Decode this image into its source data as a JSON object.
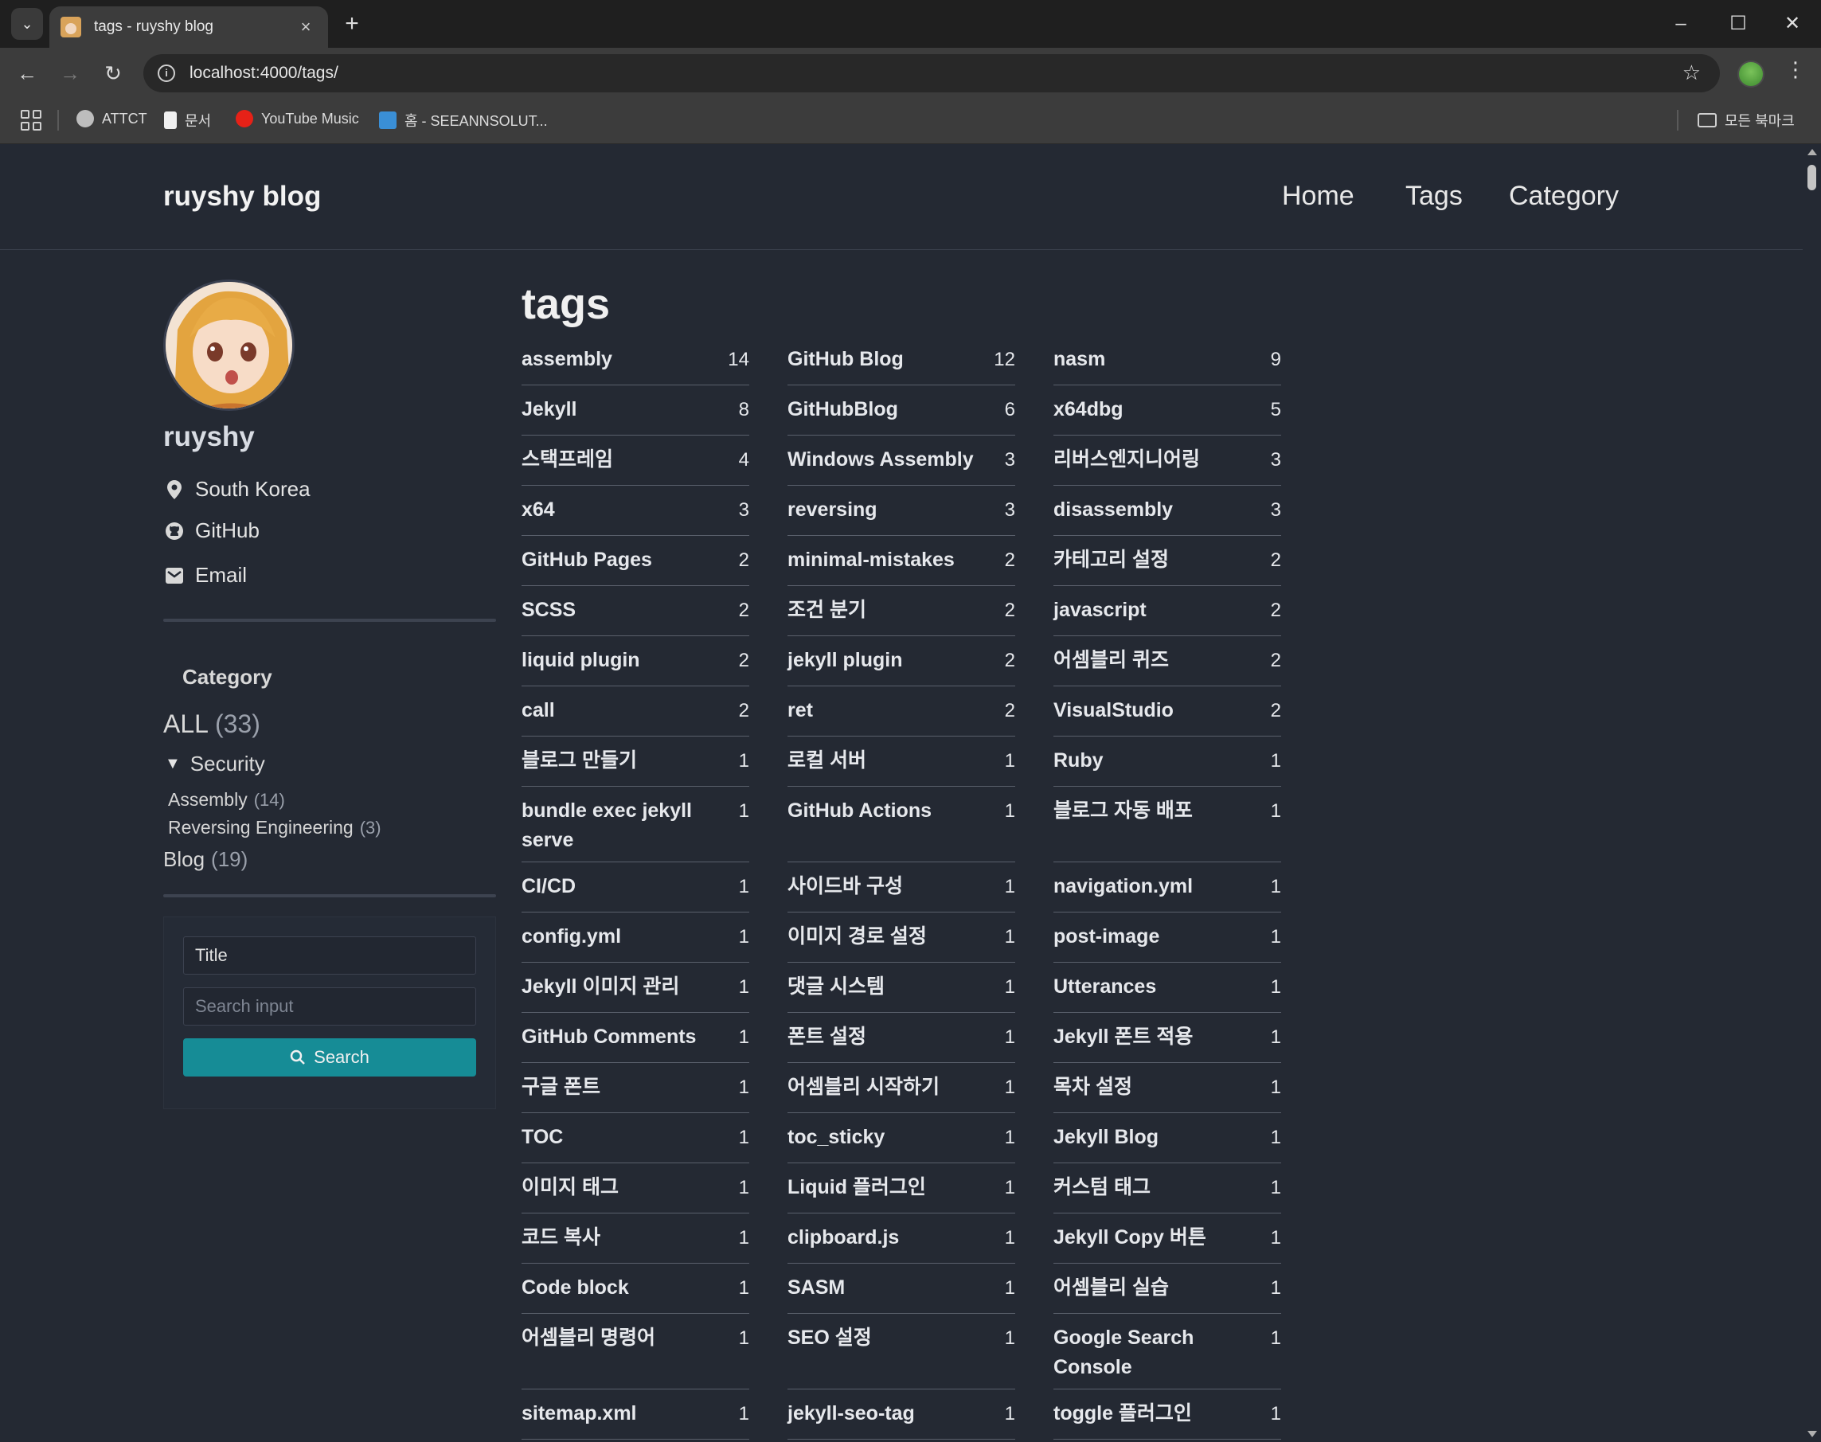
{
  "browser": {
    "tab_title": "tags - ruyshy blog",
    "url": "localhost:4000/tags/",
    "bookmarks": [
      "ATTCT",
      "문서",
      "YouTube Music",
      "홈 - SEEANNSOLUT..."
    ],
    "all_bookmarks": "모든 북마크",
    "icons": {
      "tab_list": "chevron-down-icon",
      "close": "close-icon",
      "new_tab": "plus-icon",
      "minimize": "minimize-icon",
      "maximize": "maximize-icon",
      "window_close": "close-icon",
      "back": "arrow-left-icon",
      "forward": "arrow-right-icon",
      "reload": "reload-icon",
      "info": "info-icon",
      "bookmark_star": "star-icon",
      "menu": "more-vert-icon",
      "apps": "apps-grid-icon",
      "folder": "folder-icon"
    }
  },
  "site": {
    "title": "ruyshy blog",
    "nav": [
      "Home",
      "Tags",
      "Category"
    ]
  },
  "author": {
    "name": "ruyshy",
    "location": "South Korea",
    "github": "GitHub",
    "email": "Email"
  },
  "category": {
    "heading": "Category",
    "all_label": "ALL",
    "all_count": "(33)",
    "security_label": "Security",
    "assembly_label": "Assembly",
    "assembly_count": "(14)",
    "reversing_label": "Reversing Engineering",
    "reversing_count": "(3)",
    "blog_label": "Blog",
    "blog_count": "(19)"
  },
  "search": {
    "type_value": "Title",
    "placeholder": "Search input",
    "button_label": "Search"
  },
  "page_title": "tags",
  "tags": [
    {
      "name": "assembly",
      "count": "14"
    },
    {
      "name": "GitHub Blog",
      "count": "12"
    },
    {
      "name": "nasm",
      "count": "9"
    },
    {
      "name": "Jekyll",
      "count": "8"
    },
    {
      "name": "GitHubBlog",
      "count": "6"
    },
    {
      "name": "x64dbg",
      "count": "5"
    },
    {
      "name": "스택프레임",
      "count": "4"
    },
    {
      "name": "Windows Assembly",
      "count": "3"
    },
    {
      "name": "리버스엔지니어링",
      "count": "3"
    },
    {
      "name": "x64",
      "count": "3"
    },
    {
      "name": "reversing",
      "count": "3"
    },
    {
      "name": "disassembly",
      "count": "3"
    },
    {
      "name": "GitHub Pages",
      "count": "2"
    },
    {
      "name": "minimal-mistakes",
      "count": "2"
    },
    {
      "name": "카테고리 설정",
      "count": "2"
    },
    {
      "name": "SCSS",
      "count": "2"
    },
    {
      "name": "조건 분기",
      "count": "2"
    },
    {
      "name": "javascript",
      "count": "2"
    },
    {
      "name": "liquid plugin",
      "count": "2"
    },
    {
      "name": "jekyll plugin",
      "count": "2"
    },
    {
      "name": "어셈블리 퀴즈",
      "count": "2"
    },
    {
      "name": "call",
      "count": "2"
    },
    {
      "name": "ret",
      "count": "2"
    },
    {
      "name": "VisualStudio",
      "count": "2"
    },
    {
      "name": "블로그 만들기",
      "count": "1"
    },
    {
      "name": "로컬 서버",
      "count": "1"
    },
    {
      "name": "Ruby",
      "count": "1"
    },
    {
      "name": "bundle exec jekyll serve",
      "count": "1"
    },
    {
      "name": "GitHub Actions",
      "count": "1"
    },
    {
      "name": "블로그 자동 배포",
      "count": "1"
    },
    {
      "name": "CI/CD",
      "count": "1"
    },
    {
      "name": "사이드바 구성",
      "count": "1"
    },
    {
      "name": "navigation.yml",
      "count": "1"
    },
    {
      "name": "config.yml",
      "count": "1"
    },
    {
      "name": "이미지 경로 설정",
      "count": "1"
    },
    {
      "name": "post-image",
      "count": "1"
    },
    {
      "name": "Jekyll 이미지 관리",
      "count": "1"
    },
    {
      "name": "댓글 시스템",
      "count": "1"
    },
    {
      "name": "Utterances",
      "count": "1"
    },
    {
      "name": "GitHub Comments",
      "count": "1"
    },
    {
      "name": "폰트 설정",
      "count": "1"
    },
    {
      "name": "Jekyll 폰트 적용",
      "count": "1"
    },
    {
      "name": "구글 폰트",
      "count": "1"
    },
    {
      "name": "어셈블리 시작하기",
      "count": "1"
    },
    {
      "name": "목차 설정",
      "count": "1"
    },
    {
      "name": "TOC",
      "count": "1"
    },
    {
      "name": "toc_sticky",
      "count": "1"
    },
    {
      "name": "Jekyll Blog",
      "count": "1"
    },
    {
      "name": "이미지 태그",
      "count": "1"
    },
    {
      "name": "Liquid 플러그인",
      "count": "1"
    },
    {
      "name": "커스텀 태그",
      "count": "1"
    },
    {
      "name": "코드 복사",
      "count": "1"
    },
    {
      "name": "clipboard.js",
      "count": "1"
    },
    {
      "name": "Jekyll Copy 버튼",
      "count": "1"
    },
    {
      "name": "Code block",
      "count": "1"
    },
    {
      "name": "SASM",
      "count": "1"
    },
    {
      "name": "어셈블리 실습",
      "count": "1"
    },
    {
      "name": "어셈블리 명령어",
      "count": "1"
    },
    {
      "name": "SEO 설정",
      "count": "1"
    },
    {
      "name": "Google Search Console",
      "count": "1"
    },
    {
      "name": "sitemap.xml",
      "count": "1"
    },
    {
      "name": "jekyll-seo-tag",
      "count": "1"
    },
    {
      "name": "toggle 플러그인",
      "count": "1"
    }
  ],
  "colors": {
    "page_bg": "#242933",
    "accent_button": "#168c96",
    "text": "#eaeaea"
  }
}
